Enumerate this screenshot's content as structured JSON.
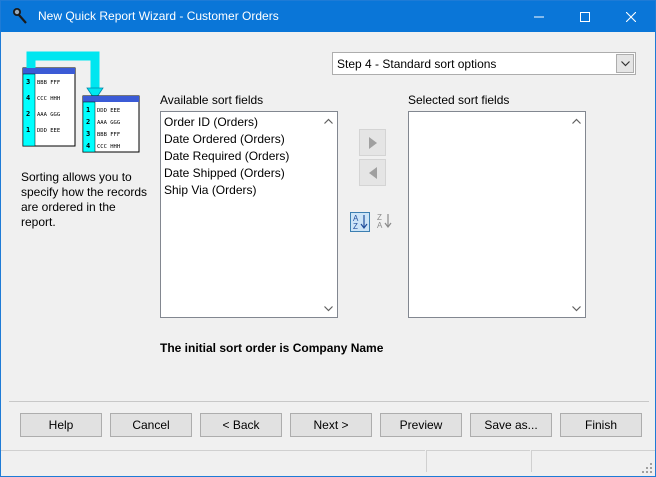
{
  "window": {
    "title": "New Quick Report Wizard - Customer Orders",
    "controls": {
      "minimize": "minimize",
      "maximize": "maximize",
      "close": "close"
    }
  },
  "step": {
    "selected": "Step 4 - Standard sort options"
  },
  "illustration": {
    "back_rows": [
      {
        "n": "3",
        "t": "BBB FFF"
      },
      {
        "n": "4",
        "t": "CCC HHH"
      },
      {
        "n": "2",
        "t": "AAA GGG"
      },
      {
        "n": "1",
        "t": "DDD EEE"
      }
    ],
    "front_rows": [
      {
        "n": "1",
        "t": "DDD EEE"
      },
      {
        "n": "2",
        "t": "AAA GGG"
      },
      {
        "n": "3",
        "t": "BBB FFF"
      },
      {
        "n": "4",
        "t": "CCC HHH"
      }
    ]
  },
  "help_text": "Sorting allows you to specify how the records are ordered in the report.",
  "available": {
    "label": "Available sort fields",
    "items": [
      "Order ID (Orders)",
      "Date Ordered (Orders)",
      "Date Required (Orders)",
      "Date Shipped (Orders)",
      "Ship Via (Orders)"
    ]
  },
  "selected": {
    "label": "Selected sort fields",
    "items": []
  },
  "initial_sort_text": "The initial sort order is Company Name",
  "buttons": {
    "help": "Help",
    "cancel": "Cancel",
    "back": "< Back",
    "next": "Next >",
    "preview": "Preview",
    "save_as": "Save as...",
    "finish": "Finish"
  },
  "colors": {
    "titlebar": "#0a76d8",
    "dialog_bg": "#f0f0f0",
    "illustration_cyan": "#00ffff",
    "illustration_header": "#00a0c8"
  }
}
